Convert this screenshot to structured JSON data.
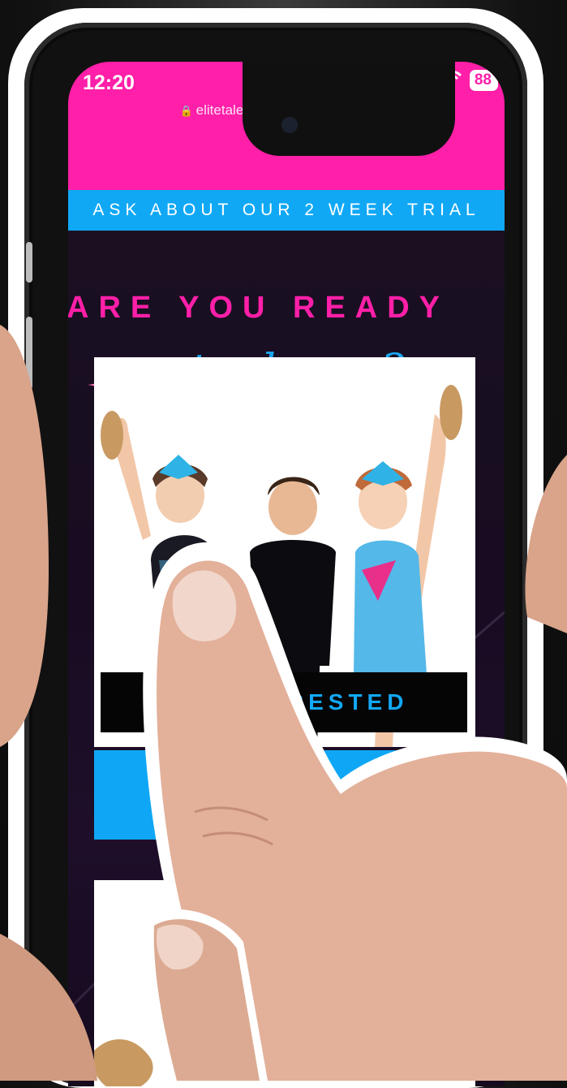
{
  "status_bar": {
    "time": "12:20",
    "battery": "88",
    "url": "elitetalentperformingarts.com.au"
  },
  "banner": {
    "text": "ASK ABOUT OUR 2 WEEK TRIAL"
  },
  "hero": {
    "heading": "ARE YOU READY",
    "script_line": "to dance?"
  },
  "cta": {
    "interested_label": "I'M INTERESTED"
  },
  "colors": {
    "pink": "#ff1fa8",
    "blue": "#10a8f5",
    "background": "#170d1f"
  },
  "icons": [
    "lock-icon",
    "signal-icon",
    "wifi-icon",
    "battery-icon",
    "sparkle-icon"
  ]
}
